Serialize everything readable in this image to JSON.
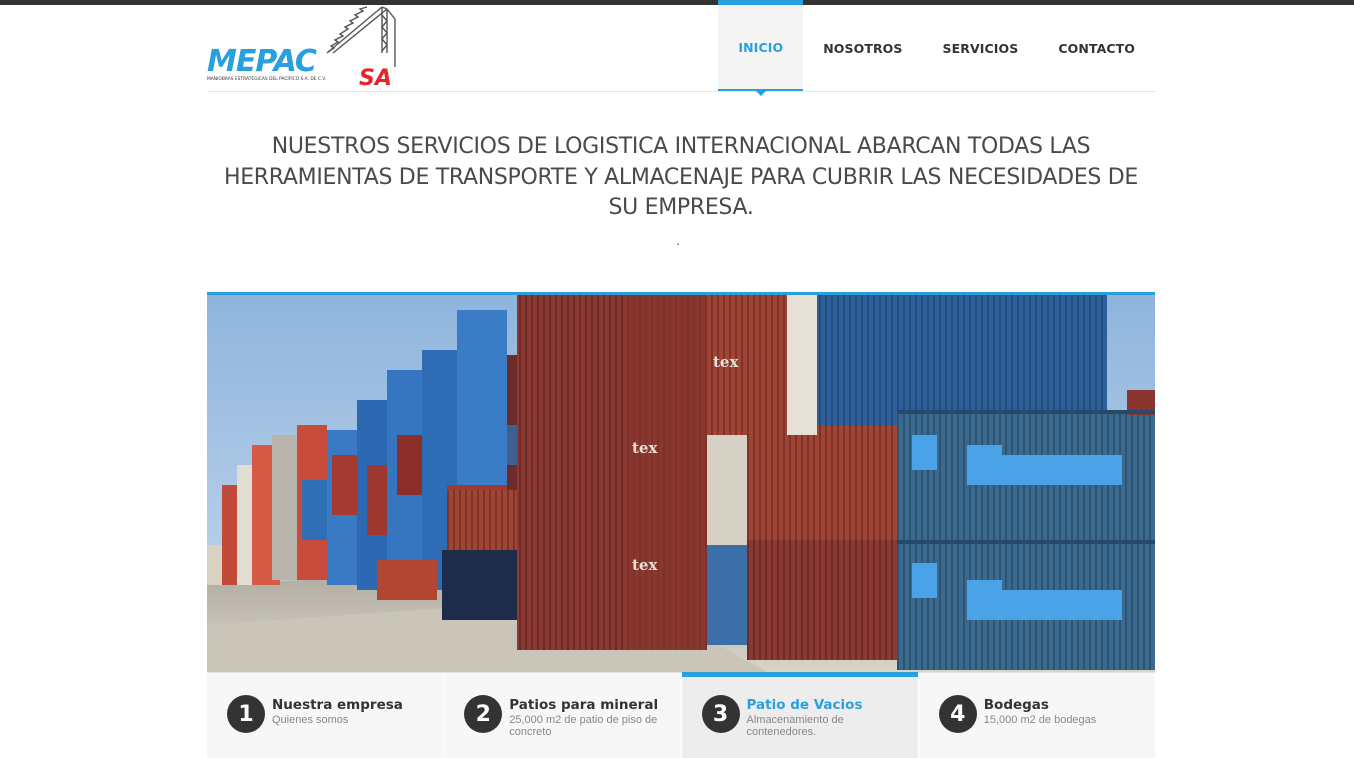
{
  "brand": {
    "logo_text": "MEPAC",
    "logo_suffix": "SA",
    "logo_tagline": "MANIOBRAS ESTRATÉGICAS DEL PACÍFICO S.A. DE C.V.",
    "primary_color": "#2a9fe0",
    "logo_red": "#e8242a"
  },
  "nav": {
    "items": [
      {
        "label": "INICIO",
        "active": true
      },
      {
        "label": "NOSOTROS",
        "active": false
      },
      {
        "label": "SERVICIOS",
        "active": false
      },
      {
        "label": "CONTACTO",
        "active": false
      }
    ]
  },
  "headline": {
    "line1": "NUESTROS SERVICIOS DE LOGISTICA INTERNACIONAL ABARCAN TODAS LAS",
    "line2": "HERRAMIENTAS DE TRANSPORTE Y ALMACENAJE PARA CUBRIR LAS NECESIDADES DE",
    "line3": "SU EMPRESA.",
    "dot": "."
  },
  "hero": {
    "container_labels": [
      "tex",
      "tex",
      "tex",
      "tex"
    ]
  },
  "tabs": [
    {
      "num": "1",
      "title": "Nuestra empresa",
      "subtitle": "Quienes somos",
      "active": false
    },
    {
      "num": "2",
      "title": "Patios para mineral",
      "subtitle": "25,000 m2 de patio de piso de concreto",
      "active": false
    },
    {
      "num": "3",
      "title": "Patio de Vacios",
      "subtitle": "Almacenamiento de contenedores.",
      "active": true
    },
    {
      "num": "4",
      "title": "Bodegas",
      "subtitle": "15,000 m2 de bodegas",
      "active": false
    }
  ]
}
